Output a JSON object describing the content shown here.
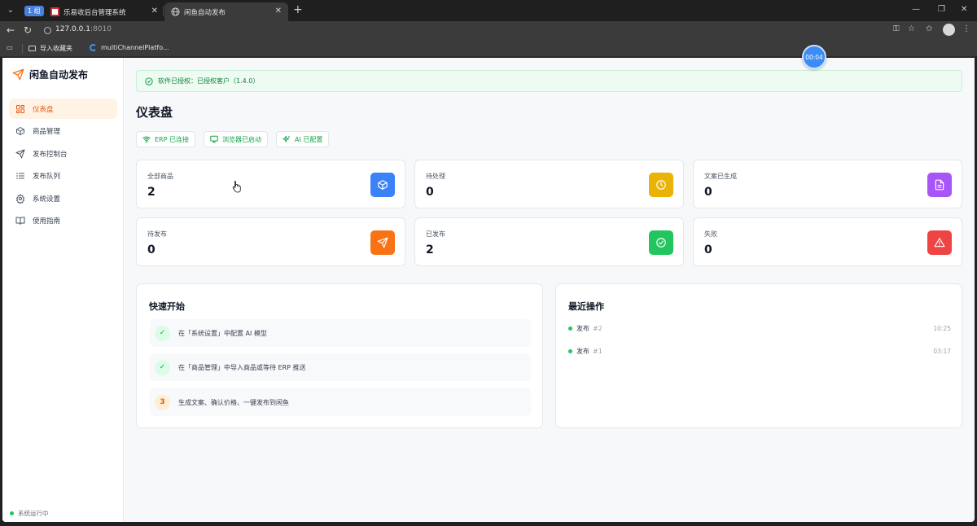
{
  "browser": {
    "tab_group": "1 组",
    "tabs": [
      {
        "title": "乐易收后台管理系统",
        "active": false
      },
      {
        "title": "闲鱼自动发布",
        "active": true
      }
    ],
    "url_host": "127.0.0.1",
    "url_port": ":8010",
    "bookmarks": [
      "导入收藏夹",
      "multiChannelPlatfo..."
    ]
  },
  "timer": "00:04",
  "sidebar": {
    "brand": "闲鱼自动发布",
    "items": [
      {
        "label": "仪表盘",
        "icon": "grid-icon",
        "active": true
      },
      {
        "label": "商品管理",
        "icon": "box-icon",
        "active": false
      },
      {
        "label": "发布控制台",
        "icon": "send-icon",
        "active": false
      },
      {
        "label": "发布队列",
        "icon": "list-icon",
        "active": false
      },
      {
        "label": "系统设置",
        "icon": "gear-icon",
        "active": false
      },
      {
        "label": "使用指南",
        "icon": "book-icon",
        "active": false
      }
    ],
    "status": "系统运行中"
  },
  "license": "软件已授权：已授权客户（1.4.0）",
  "page_title": "仪表盘",
  "status_chips": [
    "ERP 已连接",
    "浏览器已启动",
    "AI 已配置"
  ],
  "stats": [
    {
      "label": "全部商品",
      "value": "2",
      "icon": "cube-icon",
      "color": "#3b82f6"
    },
    {
      "label": "待处理",
      "value": "0",
      "icon": "clock-icon",
      "color": "#eab308"
    },
    {
      "label": "文案已生成",
      "value": "0",
      "icon": "document-icon",
      "color": "#a855f7"
    },
    {
      "label": "待发布",
      "value": "0",
      "icon": "send-icon",
      "color": "#f97316"
    },
    {
      "label": "已发布",
      "value": "2",
      "icon": "check-circle-icon",
      "color": "#22c55e"
    },
    {
      "label": "失败",
      "value": "0",
      "icon": "warning-icon",
      "color": "#ef4444"
    }
  ],
  "quick_start": {
    "title": "快速开始",
    "steps": [
      {
        "marker": "✓",
        "text": "在「系统设置」中配置 AI 模型",
        "done": true
      },
      {
        "marker": "✓",
        "text": "在「商品管理」中导入商品或等待 ERP 推送",
        "done": true
      },
      {
        "marker": "3",
        "text": "生成文案、确认价格、一键发布到闲鱼",
        "done": false
      }
    ]
  },
  "recent": {
    "title": "最近操作",
    "items": [
      {
        "action": "发布",
        "id": "#2",
        "time": "10:25"
      },
      {
        "action": "发布",
        "id": "#1",
        "time": "03:17"
      }
    ]
  }
}
